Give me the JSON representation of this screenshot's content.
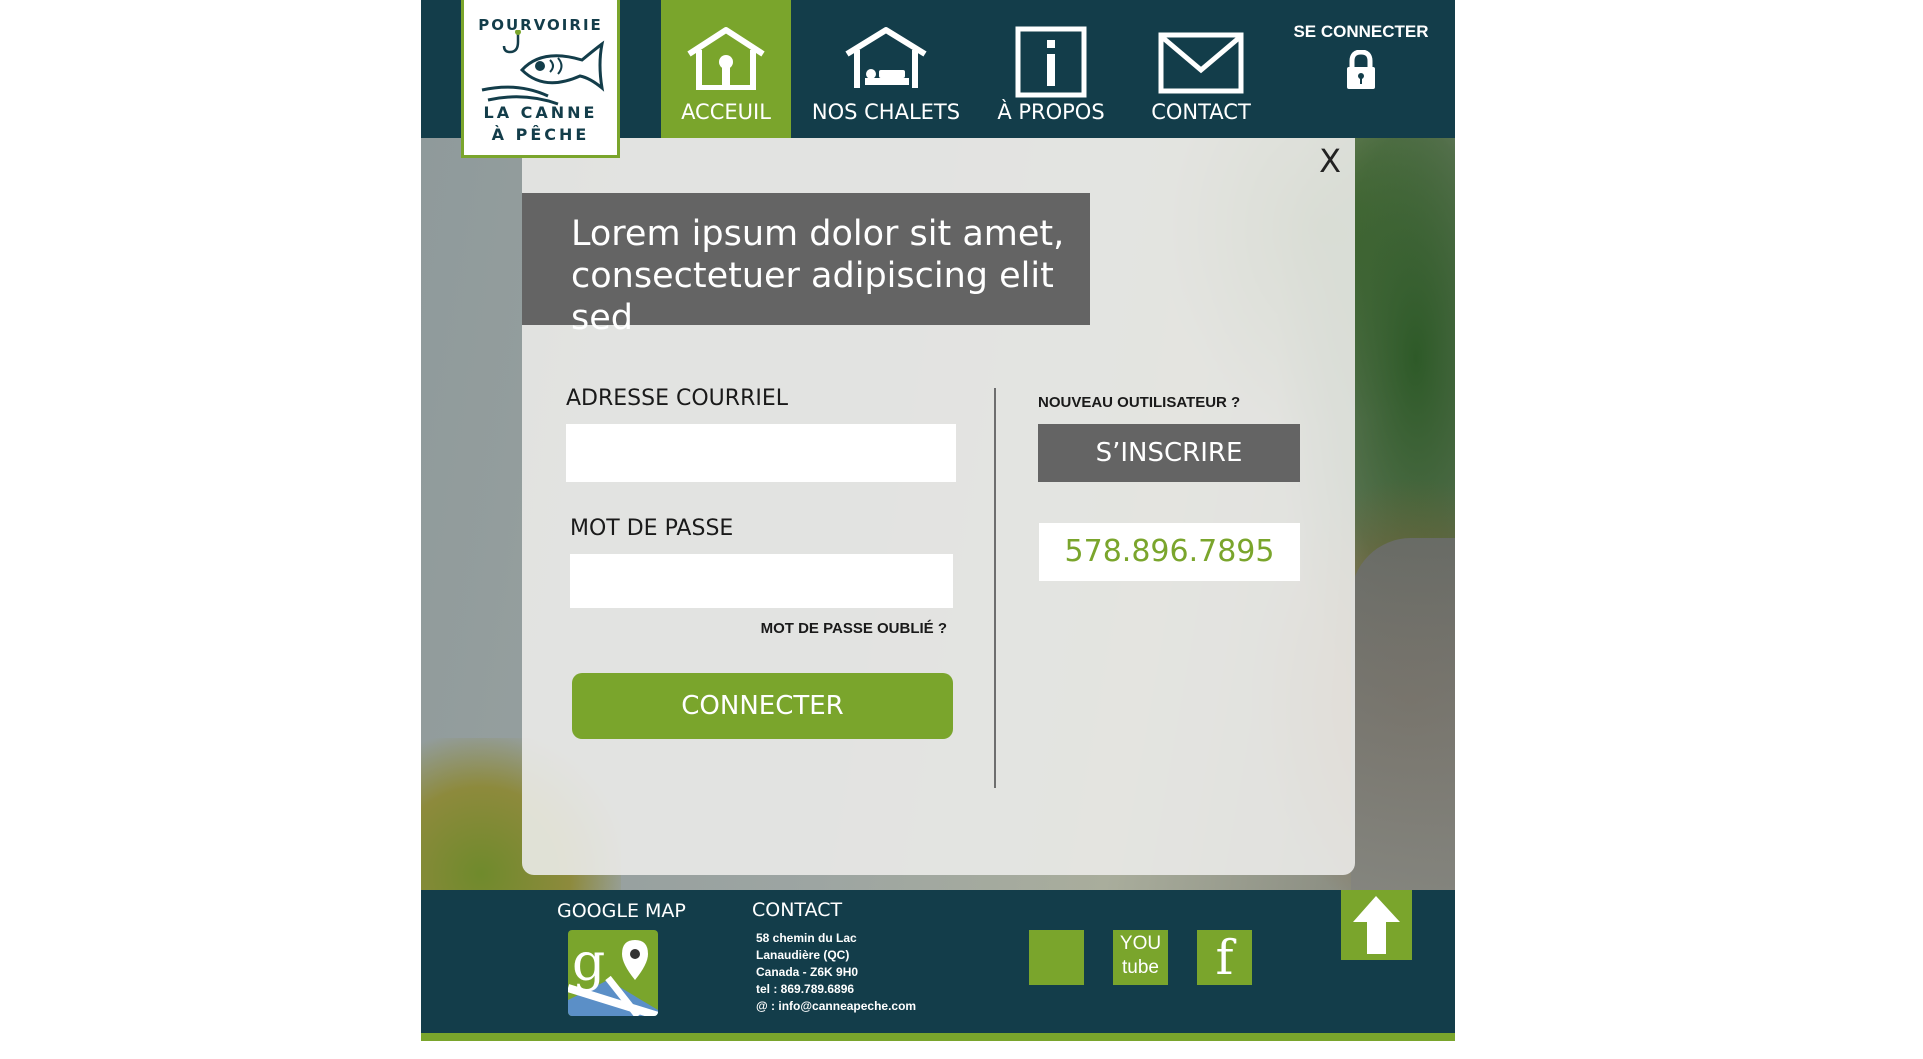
{
  "brand": {
    "logo_top": "POURVOIRIE",
    "logo_line1": "LA CANNE",
    "logo_line2": "À PÊCHE",
    "accent_color": "#7aa52c",
    "dark_color": "#133d4a"
  },
  "nav": {
    "items": [
      {
        "label": "ACCEUIL",
        "icon": "house-icon",
        "active": true
      },
      {
        "label": "NOS CHALETS",
        "icon": "bed-icon",
        "active": false
      },
      {
        "label": "À PROPOS",
        "icon": "info-icon",
        "active": false
      },
      {
        "label": "CONTACT",
        "icon": "envelope-icon",
        "active": false
      }
    ],
    "login_label": "SE CONNECTER",
    "login_icon": "lock-icon"
  },
  "modal": {
    "close_label": "X",
    "title": "Lorem ipsum dolor sit amet,\nconsectetuer adipiscing elit sed",
    "email_label": "ADRESSE COURRIEL",
    "email_value": "",
    "password_label": "MOT DE PASSE",
    "password_value": "",
    "forgot_label": "MOT DE PASSE OUBLIÉ ?",
    "connect_label": "CONNECTER",
    "new_user_label": "NOUVEAU OUTILISATEUR ?",
    "signup_label": "S’INSCRIRE",
    "phone": "578.896.7895"
  },
  "footer": {
    "gmap_title": "GOOGLE MAP",
    "contact_title": "CONTACT",
    "address": [
      "58 chemin du Lac",
      "Lanaudière (QC)",
      "Canada - Z6K 9H0",
      "tel : 869.789.6896",
      "@ : info@canneapeche.com"
    ],
    "youtube_line1": "YOU",
    "youtube_line2": "tube",
    "facebook_label": "f"
  }
}
